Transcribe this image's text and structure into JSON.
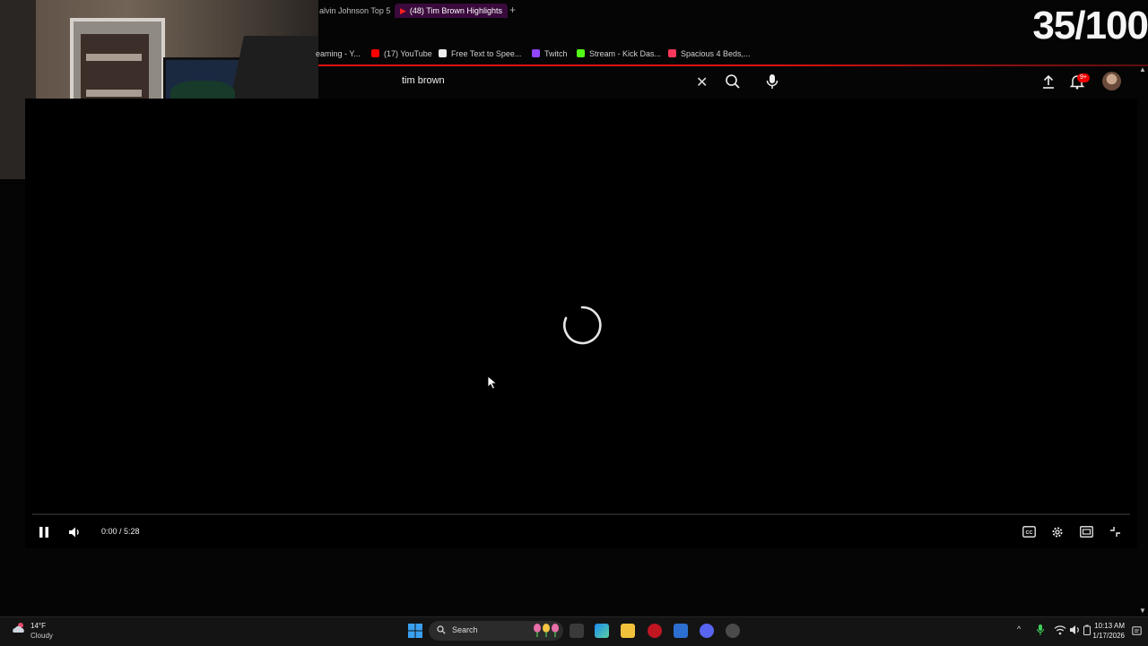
{
  "overlay": {
    "counter": "35/100"
  },
  "browser": {
    "tabs": [
      {
        "label": "alvin Johnson Top 5"
      },
      {
        "label": "(48) Tim Brown Highlights",
        "active": true
      }
    ],
    "new_tab_symbol": "+",
    "bookmarks": [
      {
        "label": "eaming - Y...",
        "icon": "youtube-icon"
      },
      {
        "label": "(17) YouTube",
        "icon": "youtube-icon"
      },
      {
        "label": "Free Text to Spee...",
        "icon": "page-icon"
      },
      {
        "label": "Twitch",
        "icon": "twitch-icon"
      },
      {
        "label": "Stream - Kick Das...",
        "icon": "kick-icon"
      },
      {
        "label": "Spacious 4 Beds,...",
        "icon": "airbnb-icon"
      }
    ]
  },
  "youtube": {
    "search_value": "tim brown",
    "clear_symbol": "✕",
    "notifications_badge": "9+"
  },
  "player": {
    "time": "0:00 / 5:28",
    "state": "loading",
    "progress": 0.0
  },
  "taskbar": {
    "weather_temp": "14°F",
    "weather_condition": "Cloudy",
    "search_label": "Search",
    "clock_time": "10:13 AM",
    "clock_date": "1/17/2026",
    "tray_chevron": "^"
  },
  "colors": {
    "youtube_red": "#ff0000",
    "active_tab": "#3a0a3d",
    "background": "#050505"
  }
}
